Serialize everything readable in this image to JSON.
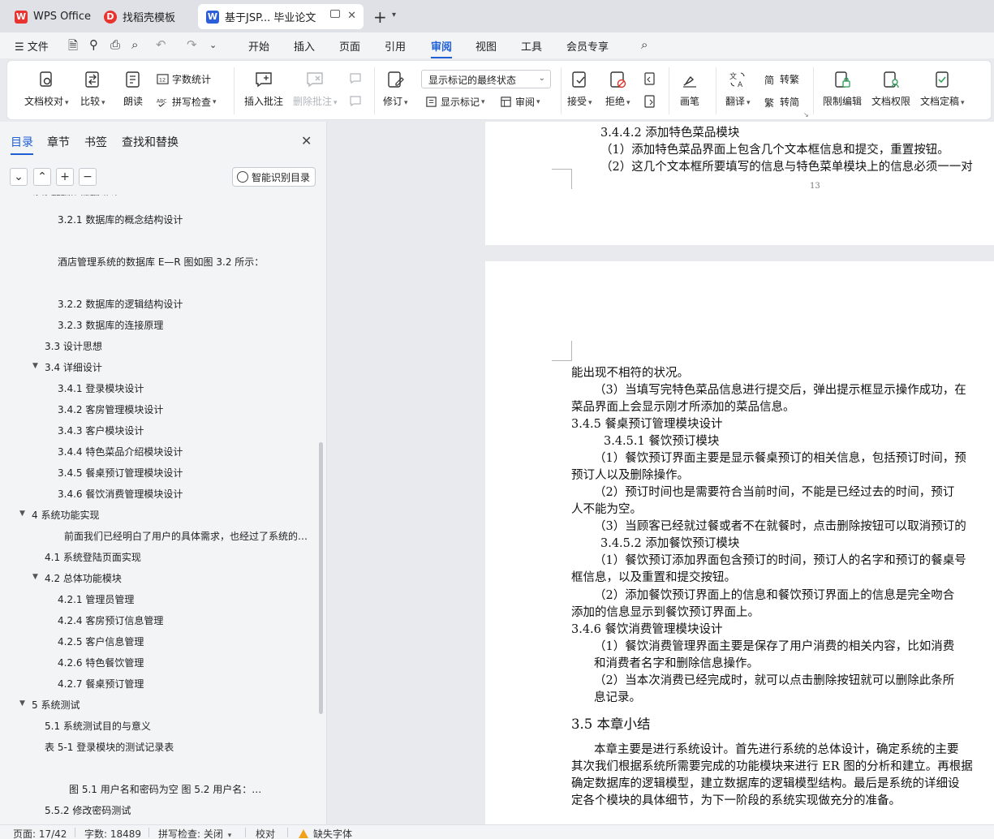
{
  "tabs": [
    {
      "label": "WPS Office",
      "icon": "wps-logo-icon",
      "color": "#e8332f"
    },
    {
      "label": "找稻壳模板",
      "icon": "docer-icon",
      "color": "#e8332f"
    },
    {
      "label": "基于JSP... 毕业论文",
      "icon": "writer-doc-icon",
      "color": "#2b5fd9"
    }
  ],
  "menu": {
    "file": "文件",
    "items": [
      "开始",
      "插入",
      "页面",
      "引用",
      "审阅",
      "视图",
      "工具",
      "会员专享"
    ],
    "active": "审阅"
  },
  "ribbon": {
    "proofread": "文档校对",
    "compare": "比较",
    "read_aloud": "朗读",
    "word_count": "字数统计",
    "spell_check": "拼写检查",
    "insert_comment": "插入批注",
    "delete_comment": "删除批注",
    "track_changes": "修订",
    "markup_state": "显示标记的最终状态",
    "show_markup": "显示标记",
    "review": "审阅",
    "accept": "接受",
    "reject": "拒绝",
    "pen": "画笔",
    "translate": "翻译",
    "to_traditional": "转繁",
    "to_simplified": "转简",
    "restrict_edit": "限制编辑",
    "doc_permission": "文档权限",
    "doc_finalize": "文档定稿"
  },
  "nav": {
    "tabs": [
      "目录",
      "章节",
      "书签",
      "查找和替换"
    ],
    "active_tab": "目录",
    "smart_toc": "智能识别目录",
    "buttons": [
      "⌄",
      "⌃",
      "+",
      "−"
    ],
    "toc": [
      {
        "text": "3.2.1 数据库的概念结构设计",
        "level": 3
      },
      {
        "text": "酒店管理系统的数据库 E—R 图如图 3.2 所示：",
        "level": 3
      },
      {
        "text": "3.2.2 数据库的逻辑结构设计",
        "level": 3
      },
      {
        "text": "3.2.3 数据库的连接原理",
        "level": 3
      },
      {
        "text": "3.3  设计思想",
        "level": 2
      },
      {
        "text": "3.4  详细设计",
        "level": 2,
        "expanded": true
      },
      {
        "text": "3.4.1  登录模块设计",
        "level": 3
      },
      {
        "text": "3.4.2  客房管理模块设计",
        "level": 3
      },
      {
        "text": "3.4.3  客户模块设计",
        "level": 3
      },
      {
        "text": "3.4.4  特色菜品介绍模块设计",
        "level": 3
      },
      {
        "text": "3.4.5  餐桌预订管理模块设计",
        "level": 3
      },
      {
        "text": "3.4.6  餐饮消费管理模块设计",
        "level": 3
      },
      {
        "text": "4  系统功能实现",
        "level": 1,
        "expanded": true
      },
      {
        "text": "前面我们已经明白了用户的具体需求，也经过了系统的…",
        "level": 3
      },
      {
        "text": "4.1 系统登陆页面实现",
        "level": 2
      },
      {
        "text": "4.2 总体功能模块",
        "level": 2,
        "expanded": true
      },
      {
        "text": "4.2.1 管理员管理",
        "level": 3
      },
      {
        "text": "4.2.4 客房预订信息管理",
        "level": 3
      },
      {
        "text": "4.2.5 客户信息管理",
        "level": 3
      },
      {
        "text": "4.2.6 特色餐饮管理",
        "level": 3
      },
      {
        "text": "4.2.7 餐桌预订管理",
        "level": 3
      },
      {
        "text": "5  系统测试",
        "level": 1,
        "expanded": true
      },
      {
        "text": "5.1 系统测试目的与意义",
        "level": 2
      },
      {
        "text": "表 5-1 登录模块的测试记录表",
        "level": 2
      },
      {
        "text": "图 5.1 用户名和密码为空          图 5.2  用户名：…",
        "level": 3
      },
      {
        "text": "5.5.2  修改密码测试",
        "level": 2
      }
    ]
  },
  "doc": {
    "page1_lines": [
      "3.4.4.2  添加特色菜品模块",
      "（1）添加特色菜品界面上包含几个文本框信息和提交，重置按钮。",
      "（2）这几个文本框所要填写的信息与特色菜单模块上的信息必须一一对"
    ],
    "page_number": "13",
    "page2_lines": [
      "能出现不相符的状况。",
      "（3）当填写完特色菜品信息进行提交后，弹出提示框显示操作成功，在",
      "菜品界面上会显示刚才所添加的菜品信息。",
      "3.4.5  餐桌预订管理模块设计",
      "3.4.5.1  餐饮预订模块",
      "（1）餐饮预订界面主要是显示餐桌预订的相关信息，包括预订时间，预",
      "预订人以及删除操作。",
      "（2）预订时间也是需要符合当前时间，不能是已经过去的时间，预订",
      "人不能为空。",
      "（3）当顾客已经就过餐或者不在就餐时，点击删除按钮可以取消预订的",
      "3.4.5.2  添加餐饮预订模块",
      "（1）餐饮预订添加界面包含预订的时间，预订人的名字和预订的餐桌号",
      "框信息，以及重置和提交按钮。",
      "（2）添加餐饮预订界面上的信息和餐饮预订界面上的信息是完全吻合",
      "添加的信息显示到餐饮预订界面上。",
      "3.4.6  餐饮消费管理模块设计",
      "（1）餐饮消费管理界面主要是保存了用户消费的相关内容，比如消费",
      "和消费者名字和删除信息操作。",
      "（2）当本次消费已经完成时，就可以点击删除按钮就可以删除此条所",
      "息记录。",
      "3.5  本章小结",
      "本章主要是进行系统设计。首先进行系统的总体设计，确定系统的主要",
      "其次我们根据系统所需要完成的功能模块来进行 ER 图的分析和建立。再根据",
      "确定数据库的逻辑模型，建立数据库的逻辑模型结构。最后是系统的详细设",
      "定各个模块的具体细节，为下一阶段的系统实现做充分的准备。"
    ]
  },
  "status": {
    "page": "页面: 17/42",
    "words": "字数: 18489",
    "spell": "拼写检查: 关闭",
    "proof": "校对",
    "missing_font": "缺失字体"
  }
}
